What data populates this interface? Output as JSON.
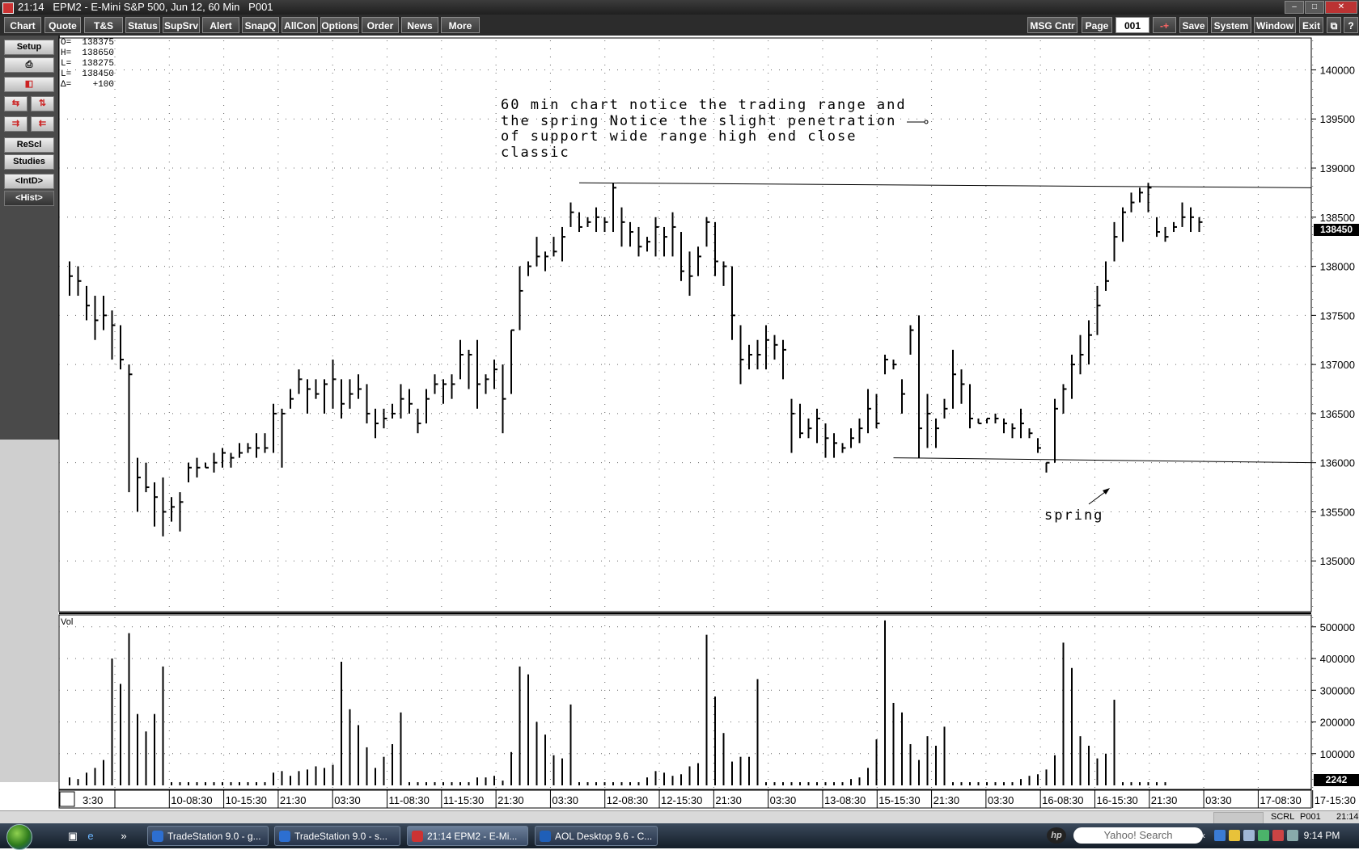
{
  "window": {
    "title": "21:14   EPM2 - E-Mini S&P 500, Jun 12, 60 Min   P001"
  },
  "menu": {
    "left": [
      "Chart",
      "Quote",
      "T&S",
      "Status",
      "SupSrv",
      "Alert",
      "SnapQ",
      "AllCon",
      "Options",
      "Order",
      "News",
      "More"
    ],
    "msg": "MSG Cntr",
    "page_label": "Page",
    "page_value": "001",
    "pm": "-+",
    "right": [
      "Save",
      "System",
      "Window",
      "Exit"
    ],
    "help": "?"
  },
  "sidebar": {
    "setup": "Setup",
    "rescl": "ReScl",
    "studies": "Studies",
    "intd": "<IntD>",
    "hist": "<Hist>"
  },
  "ohlc": {
    "o": "O=  138375",
    "h": "H=  138650",
    "l": "L=  138275",
    "c": "L=  138450",
    "d": "Δ=    +100"
  },
  "annotation": "60 min chart notice the trading range and\nthe spring  Notice the slight penetration\nof support wide range high end close\nclassic",
  "spring_label": "spring",
  "last_price": "138450",
  "vol_label": "Vol",
  "vol_last": "2242",
  "status": {
    "scrl": "SCRL",
    "page": "P001",
    "time": "21:14"
  },
  "taskbar": {
    "tasks": [
      "TradeStation 9.0 - g...",
      "TradeStation 9.0 - s...",
      "21:14   EPM2 - E-Mi...",
      "AOL Desktop 9.6 - C..."
    ],
    "search": "Yahoo! Search",
    "clock": "9:14 PM"
  },
  "colors": {
    "accent_red": "#cc2222",
    "taskbar": "#1c2636"
  },
  "chart_data": {
    "type": "bar",
    "price_axis": {
      "ylim": [
        134500,
        140300
      ],
      "ticks": [
        135000,
        135500,
        136000,
        136500,
        137000,
        137500,
        138000,
        138500,
        139000,
        139500,
        140000
      ],
      "tick_labels": [
        "135000",
        "135500",
        "136000",
        "136500",
        "137000",
        "137500",
        "138000",
        "138500",
        "139000",
        "139500",
        "140000"
      ]
    },
    "volume_axis": {
      "ylim": [
        0,
        530000
      ],
      "ticks": [
        100000,
        200000,
        300000,
        400000,
        500000
      ],
      "tick_labels": [
        "100000",
        "200000",
        "300000",
        "400000",
        "500000"
      ]
    },
    "x_labels": [
      "3:30",
      "10-08:30",
      "10-15:30",
      "21:30",
      "03:30",
      "11-08:30",
      "11-15:30",
      "21:30",
      "03:30",
      "12-08:30",
      "12-15:30",
      "21:30",
      "03:30",
      "13-08:30",
      "15-15:30",
      "21:30",
      "03:30",
      "16-08:30",
      "16-15:30",
      "21:30",
      "03:30",
      "17-08:30",
      "17-15:30"
    ],
    "bars": [
      [
        138050,
        137700,
        137900
      ],
      [
        138000,
        137700,
        137850
      ],
      [
        137800,
        137450,
        137600
      ],
      [
        137700,
        137250,
        137450
      ],
      [
        137700,
        137350,
        137500
      ],
      [
        137550,
        137050,
        137400
      ],
      [
        137400,
        136950,
        137050
      ],
      [
        137000,
        135700,
        136900
      ],
      [
        136050,
        135500,
        135850
      ],
      [
        136000,
        135700,
        135750
      ],
      [
        135800,
        135350,
        135650
      ],
      [
        135850,
        135250,
        135500
      ],
      [
        135650,
        135400,
        135550
      ],
      [
        135700,
        135300,
        135600
      ],
      [
        136000,
        135800,
        135950
      ],
      [
        136050,
        135850,
        135950
      ],
      [
        136000,
        135950,
        135950
      ],
      [
        136100,
        135900,
        136000
      ],
      [
        136150,
        135950,
        136100
      ],
      [
        136100,
        135950,
        136050
      ],
      [
        136200,
        136050,
        136100
      ],
      [
        136200,
        136100,
        136150
      ],
      [
        136300,
        136050,
        136150
      ],
      [
        136300,
        136100,
        136150
      ],
      [
        136600,
        136100,
        136500
      ],
      [
        136550,
        135950,
        136500
      ],
      [
        136750,
        136550,
        136650
      ],
      [
        136950,
        136700,
        136850
      ],
      [
        136850,
        136500,
        136750
      ],
      [
        136850,
        136650,
        136700
      ],
      [
        136850,
        136500,
        136800
      ],
      [
        137050,
        136550,
        136850
      ],
      [
        136850,
        136450,
        136600
      ],
      [
        136850,
        136550,
        136700
      ],
      [
        136900,
        136650,
        136750
      ],
      [
        136800,
        136400,
        136500
      ],
      [
        136550,
        136250,
        136400
      ],
      [
        136550,
        136350,
        136450
      ],
      [
        136600,
        136450,
        136500
      ],
      [
        136800,
        136450,
        136650
      ],
      [
        136750,
        136500,
        136600
      ],
      [
        136550,
        136300,
        136400
      ],
      [
        136750,
        136400,
        136650
      ],
      [
        136900,
        136700,
        136800
      ],
      [
        136850,
        136600,
        136800
      ],
      [
        136900,
        136650,
        136800
      ],
      [
        137250,
        136850,
        137100
      ],
      [
        137150,
        136750,
        137100
      ],
      [
        137250,
        136550,
        136800
      ],
      [
        136900,
        136700,
        136850
      ],
      [
        137050,
        136750,
        136950
      ],
      [
        137000,
        136300,
        136650
      ],
      [
        137350,
        136700,
        137350
      ],
      [
        138000,
        137350,
        137750
      ],
      [
        138050,
        137900,
        138000
      ],
      [
        138300,
        138000,
        138100
      ],
      [
        138150,
        137950,
        138100
      ],
      [
        138300,
        138100,
        138150
      ],
      [
        138400,
        138050,
        138300
      ],
      [
        138650,
        138400,
        138550
      ],
      [
        138550,
        138350,
        138400
      ],
      [
        138500,
        138400,
        138450
      ],
      [
        138600,
        138350,
        138500
      ],
      [
        138500,
        138350,
        138450
      ],
      [
        138850,
        138350,
        138800
      ],
      [
        138600,
        138200,
        138450
      ],
      [
        138450,
        138200,
        138350
      ],
      [
        138400,
        138100,
        138200
      ],
      [
        138300,
        138150,
        138250
      ],
      [
        138500,
        138100,
        138400
      ],
      [
        138400,
        138100,
        138300
      ],
      [
        138550,
        138100,
        138400
      ],
      [
        138350,
        137850,
        137950
      ],
      [
        138150,
        137700,
        137900
      ],
      [
        138200,
        137900,
        138100
      ],
      [
        138500,
        138200,
        138450
      ],
      [
        138450,
        137900,
        138050
      ],
      [
        138050,
        137800,
        138000
      ],
      [
        138000,
        137250,
        137500
      ],
      [
        137400,
        136800,
        137050
      ],
      [
        137200,
        136950,
        137100
      ],
      [
        137250,
        136950,
        137100
      ],
      [
        137400,
        136950,
        137250
      ],
      [
        137300,
        137050,
        137200
      ],
      [
        137250,
        136850,
        137150
      ],
      [
        136650,
        136100,
        136500
      ],
      [
        136600,
        136250,
        136300
      ],
      [
        136450,
        136250,
        136350
      ],
      [
        136550,
        136200,
        136450
      ],
      [
        136400,
        136050,
        136250
      ],
      [
        136300,
        136050,
        136200
      ],
      [
        136200,
        136100,
        136150
      ],
      [
        136350,
        136150,
        136250
      ],
      [
        136450,
        136200,
        136350
      ],
      [
        136750,
        136300,
        136550
      ],
      [
        136700,
        136350,
        136400
      ],
      [
        137100,
        136900,
        137050
      ],
      [
        137050,
        136950,
        137000
      ],
      [
        136850,
        136500,
        136700
      ],
      [
        137400,
        137100,
        137350
      ],
      [
        137500,
        136050,
        136350
      ],
      [
        136700,
        136150,
        136500
      ],
      [
        136450,
        136150,
        136350
      ],
      [
        136650,
        136450,
        136550
      ],
      [
        137150,
        136550,
        136900
      ],
      [
        136950,
        136600,
        136800
      ],
      [
        136800,
        136350,
        136450
      ],
      [
        136450,
        136400,
        136400
      ],
      [
        136450,
        136400,
        136450
      ],
      [
        136500,
        136400,
        136450
      ],
      [
        136450,
        136300,
        136400
      ],
      [
        136400,
        136250,
        136350
      ],
      [
        136550,
        136250,
        136400
      ],
      [
        136350,
        136250,
        136300
      ],
      [
        136250,
        136100,
        136150
      ],
      [
        136000,
        135900,
        136000
      ],
      [
        136650,
        136000,
        136550
      ],
      [
        136800,
        136500,
        136750
      ],
      [
        137100,
        136650,
        137000
      ],
      [
        137300,
        136900,
        137100
      ],
      [
        137450,
        137000,
        137300
      ],
      [
        137800,
        137300,
        137600
      ],
      [
        138050,
        137750,
        137850
      ],
      [
        138450,
        138050,
        138300
      ],
      [
        138600,
        138250,
        138550
      ],
      [
        138750,
        138550,
        138650
      ],
      [
        138800,
        138650,
        138750
      ],
      [
        138850,
        138550,
        138800
      ],
      [
        138500,
        138300,
        138350
      ],
      [
        138400,
        138250,
        138300
      ],
      [
        138450,
        138350,
        138400
      ],
      [
        138650,
        138400,
        138500
      ],
      [
        138600,
        138350,
        138500
      ],
      [
        138500,
        138350,
        138450
      ]
    ],
    "volume": [
      25000,
      20000,
      40000,
      55000,
      80000,
      400000,
      320000,
      480000,
      225000,
      170000,
      225000,
      375000,
      10000,
      10000,
      10000,
      10000,
      10000,
      10000,
      10000,
      10000,
      10000,
      10000,
      10000,
      10000,
      40000,
      45000,
      30000,
      45000,
      50000,
      60000,
      55000,
      65000,
      390000,
      240000,
      190000,
      120000,
      55000,
      90000,
      130000,
      230000,
      10000,
      10000,
      10000,
      10000,
      10000,
      10000,
      10000,
      10000,
      25000,
      25000,
      30000,
      15000,
      105000,
      375000,
      350000,
      200000,
      160000,
      95000,
      85000,
      255000,
      10000,
      10000,
      10000,
      10000,
      10000,
      10000,
      10000,
      10000,
      25000,
      45000,
      40000,
      30000,
      35000,
      60000,
      70000,
      475000,
      280000,
      165000,
      75000,
      90000,
      90000,
      335000,
      10000,
      10000,
      10000,
      10000,
      10000,
      10000,
      10000,
      10000,
      10000,
      10000,
      20000,
      25000,
      55000,
      145000,
      520000,
      260000,
      230000,
      130000,
      80000,
      155000,
      125000,
      185000,
      10000,
      10000,
      10000,
      10000,
      10000,
      10000,
      10000,
      10000,
      20000,
      30000,
      35000,
      50000,
      95000,
      450000,
      370000,
      155000,
      125000,
      85000,
      100000,
      270000,
      10000,
      10000,
      10000,
      10000,
      10000,
      10000
    ],
    "trendlines": [
      {
        "from": [
          60,
          138850
        ],
        "to": [
          135,
          138800
        ]
      },
      {
        "from": [
          97,
          136050
        ],
        "to": [
          135,
          136000
        ]
      }
    ]
  }
}
